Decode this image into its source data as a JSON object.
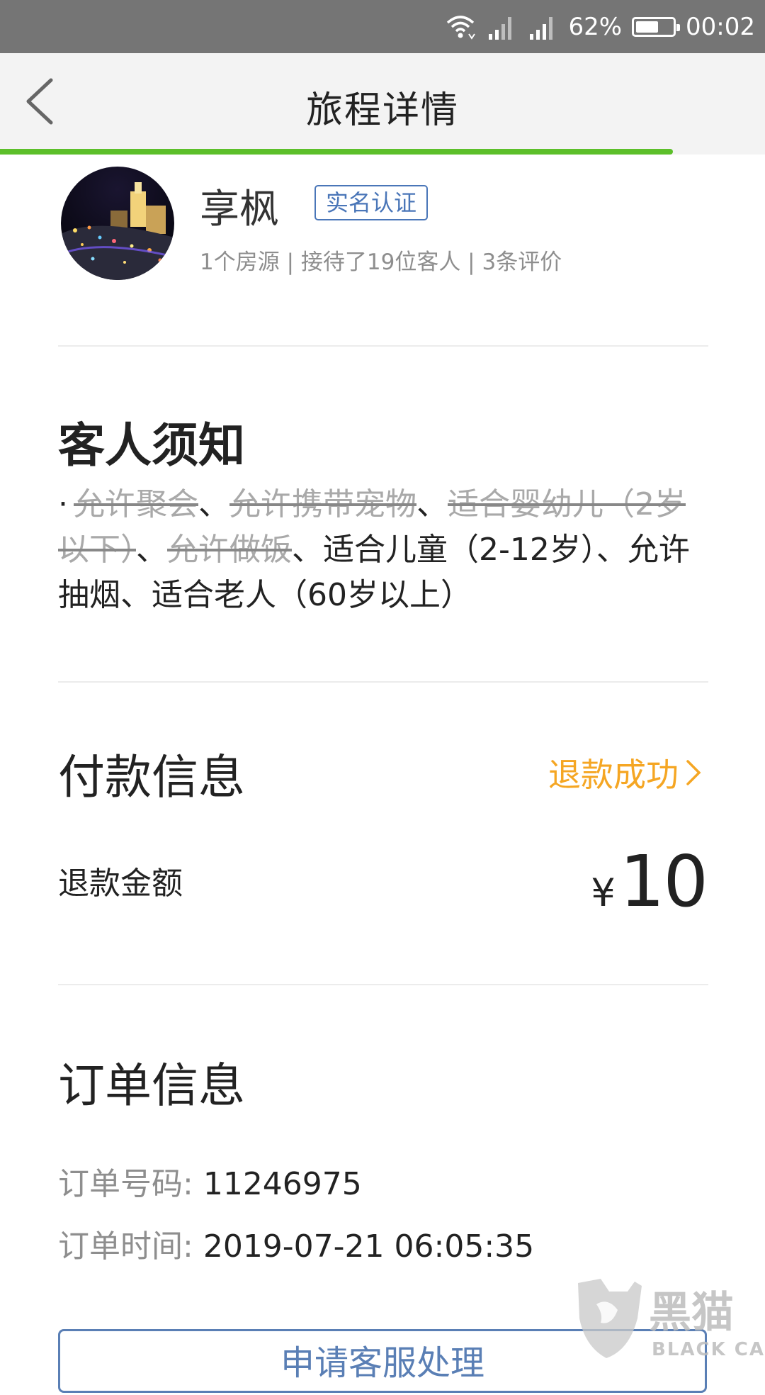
{
  "status_bar": {
    "battery": "62%",
    "time": "00:02",
    "battery_level": 0.62
  },
  "header": {
    "title": "旅程详情",
    "load_progress": 0.88
  },
  "host": {
    "name": "享枫",
    "badge": "实名认证",
    "stats": "1个房源 | 接待了19位客人 | 3条评价"
  },
  "guest_notice": {
    "title": "客人须知",
    "bullet": "·",
    "items": [
      {
        "text": "允许聚会",
        "allowed": false
      },
      {
        "text": "、",
        "allowed": true
      },
      {
        "text": "允许携带宠物",
        "allowed": false
      },
      {
        "text": "、",
        "allowed": true
      },
      {
        "text": "适合婴幼儿（2岁以下）",
        "allowed": false
      },
      {
        "text": "、",
        "allowed": true
      },
      {
        "text": "允许做饭",
        "allowed": false
      },
      {
        "text": "、适合儿童（2-12岁）、允许抽烟、适合老人（60岁以上）",
        "allowed": true
      }
    ]
  },
  "payment": {
    "title": "付款信息",
    "status": "退款成功",
    "refund_label": "退款金额",
    "currency": "¥",
    "refund_amount": "10"
  },
  "order": {
    "title": "订单信息",
    "number_label": "订单号码:",
    "number": "11246975",
    "time_label": "订单时间:",
    "time": "2019-07-21 06:05:35"
  },
  "bottom_button": {
    "label": "申请客服处理"
  },
  "watermark": {
    "cn": "黑猫",
    "en": "BLACK CAT"
  }
}
